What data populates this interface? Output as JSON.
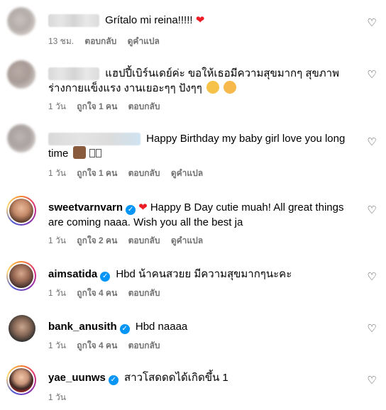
{
  "comments": [
    {
      "user_display": "",
      "text": "Grítalo mi reina!!!!!",
      "heart": "❤",
      "meta": {
        "time": "13 ชม.",
        "likes": "",
        "reply": "ตอบกลับ",
        "translate": "ดูคำแปล"
      }
    },
    {
      "user_display": "",
      "text_line1": "แฮปปี้เบิร์นเดย์ค่ะ ขอให้เธอมีความสุขมากๆ สุขภาพ",
      "text_line2": "ร่างกายแข็งแรง งานเยอะๆๆ ปังๆๆ",
      "meta": {
        "time": "1 วัน",
        "likes": "ถูกใจ 1 คน",
        "reply": "ตอบกลับ",
        "translate": ""
      }
    },
    {
      "user_display": "",
      "text_line1": "Happy Birthday my baby girl love you long",
      "text_line2": "time",
      "meta": {
        "time": "1 วัน",
        "likes": "ถูกใจ 1 คน",
        "reply": "ตอบกลับ",
        "translate": "ดูคำแปล"
      }
    },
    {
      "username": "sweetvarnvarn",
      "text_line1": "Happy B Day cutie muah! All great things",
      "text_line2": "are coming naaa. Wish you all the best ja",
      "heart": "❤",
      "meta": {
        "time": "1 วัน",
        "likes": "ถูกใจ 2 คน",
        "reply": "ตอบกลับ",
        "translate": "ดูคำแปล"
      }
    },
    {
      "username": "aimsatida",
      "text": "Hbd น้าคนสวยย มีความสุขมากๆนะคะ",
      "meta": {
        "time": "1 วัน",
        "likes": "ถูกใจ 4 คน",
        "reply": "ตอบกลับ",
        "translate": ""
      }
    },
    {
      "username": "bank_anusith",
      "text": "Hbd naaaa",
      "meta": {
        "time": "1 วัน",
        "likes": "ถูกใจ 4 คน",
        "reply": "ตอบกลับ",
        "translate": ""
      }
    },
    {
      "username": "yae_uunws",
      "text": "สาวโสดดดได้เกิดขึ้น 1",
      "meta": {
        "time": "1 วัน",
        "likes": "",
        "reply": "",
        "translate": ""
      }
    }
  ],
  "icons": {
    "like": "heart-outline-icon",
    "verified": "verified-badge-icon"
  },
  "colors": {
    "meta_text": "#737373",
    "verified": "#0095f6",
    "heart": "#ed1c24"
  }
}
